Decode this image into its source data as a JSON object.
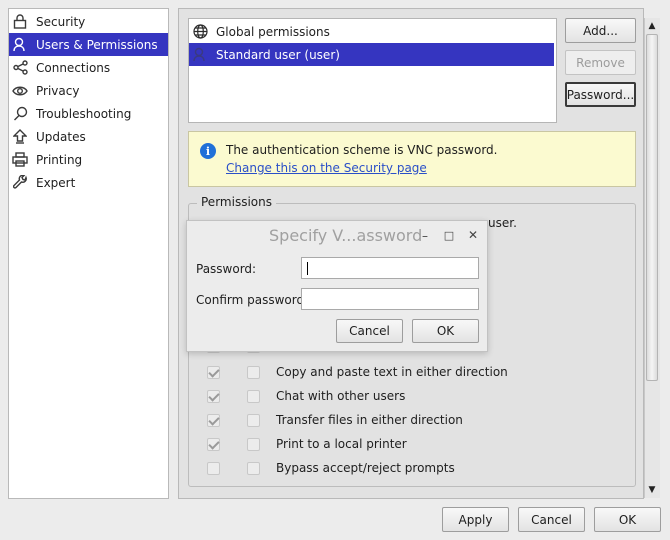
{
  "sidebar": {
    "items": [
      {
        "label": "Security",
        "icon": "lock-icon"
      },
      {
        "label": "Users & Permissions",
        "icon": "user-icon",
        "selected": true
      },
      {
        "label": "Connections",
        "icon": "share-icon"
      },
      {
        "label": "Privacy",
        "icon": "eye-icon"
      },
      {
        "label": "Troubleshooting",
        "icon": "magnifier-icon"
      },
      {
        "label": "Updates",
        "icon": "upload-arrow-icon"
      },
      {
        "label": "Printing",
        "icon": "printer-icon"
      },
      {
        "label": "Expert",
        "icon": "wrench-icon"
      }
    ]
  },
  "users": {
    "items": [
      {
        "label": "Global permissions",
        "icon": "globe-icon"
      },
      {
        "label": "Standard user (user)",
        "icon": "user-icon",
        "selected": true
      }
    ],
    "buttons": {
      "add": "Add...",
      "remove": "Remove",
      "password": "Password..."
    }
  },
  "info": {
    "text": "The authentication scheme is VNC password.",
    "link": "Change this on the Security page"
  },
  "permissions": {
    "title": "Permissions",
    "partial_text": "user.",
    "rows": [
      {
        "label": "Copy and paste text in either direction",
        "col1": true,
        "col2": false
      },
      {
        "label": "Chat with other users",
        "col1": true,
        "col2": false
      },
      {
        "label": "Transfer files in either direction",
        "col1": true,
        "col2": false
      },
      {
        "label": "Print to a local printer",
        "col1": true,
        "col2": false
      },
      {
        "label": "Bypass accept/reject prompts",
        "col1": false,
        "col2": false
      }
    ]
  },
  "footer": {
    "apply": "Apply",
    "cancel": "Cancel",
    "ok": "OK"
  },
  "dialog": {
    "title": "Specify V...assword",
    "password_label": "Password:",
    "password_value": "",
    "confirm_label": "Confirm password:",
    "confirm_value": "",
    "cancel": "Cancel",
    "ok": "OK",
    "minimize_glyph": "–",
    "maximize_glyph": "□",
    "close_glyph": "✕"
  },
  "colors": {
    "selection": "#3535c0",
    "info_bg": "#fbfad0",
    "link": "#2a4fc8"
  }
}
